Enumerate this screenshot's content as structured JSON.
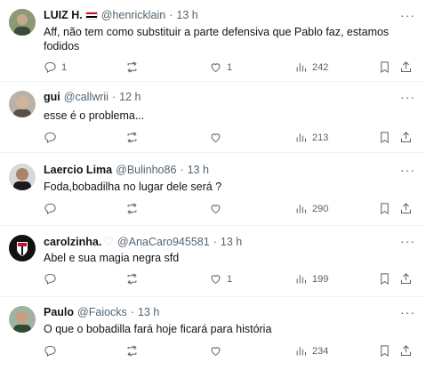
{
  "tweets": [
    {
      "name": "LUIZ H.",
      "handle": "@henricklain",
      "time": "13 h",
      "text": "Aff, não tem como substituir a parte defensiva que Pablo faz, estamos fodidos",
      "replies": "1",
      "retweets": "",
      "likes": "1",
      "views": "242",
      "flag_colors": [
        "#ce1126",
        "#ffffff",
        "#000000"
      ]
    },
    {
      "name": "gui",
      "handle": "@callwrii",
      "time": "12 h",
      "text": "esse é o problema...",
      "replies": "",
      "retweets": "",
      "likes": "",
      "views": "213"
    },
    {
      "name": "Laercio Lima",
      "handle": "@Bulinho86",
      "time": "13 h",
      "text": "Foda,bobadilha no lugar dele será ?",
      "replies": "",
      "retweets": "",
      "likes": "",
      "views": "290"
    },
    {
      "name": "carolzinha.",
      "handle": "@AnaCaro945581",
      "time": "13 h",
      "text": "Abel e sua magia negra sfd",
      "replies": "",
      "retweets": "",
      "likes": "1",
      "views": "199"
    },
    {
      "name": "Paulo",
      "handle": "@Faiocks",
      "time": "13 h",
      "text": "O que o bobadilla fará hoje ficará para história",
      "replies": "",
      "retweets": "",
      "likes": "",
      "views": "234"
    }
  ],
  "dot": "·",
  "more_glyph": "···",
  "heart_badge": "♡"
}
